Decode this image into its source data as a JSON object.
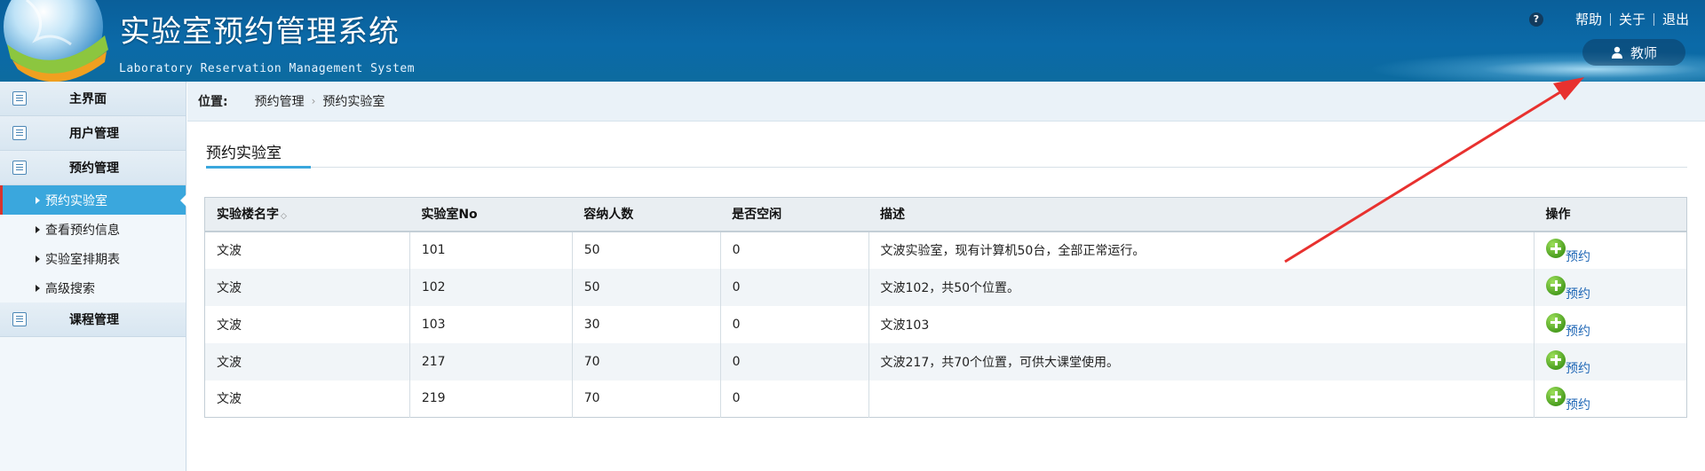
{
  "header": {
    "title": "实验室预约管理系统",
    "subtitle": "Laboratory Reservation Management System",
    "help_icon": "?",
    "links": [
      "帮助",
      "关于",
      "退出"
    ],
    "user_label": "教师",
    "user_icon": "user-icon"
  },
  "sidebar": {
    "sections": [
      {
        "label": "主界面",
        "icon": "list-icon"
      },
      {
        "label": "用户管理",
        "icon": "list-icon"
      },
      {
        "label": "预约管理",
        "icon": "list-icon"
      },
      {
        "label": "课程管理",
        "icon": "list-icon"
      }
    ],
    "items": [
      {
        "label": "预约实验室",
        "active": true
      },
      {
        "label": "查看预约信息",
        "active": false
      },
      {
        "label": "实验室排期表",
        "active": false
      },
      {
        "label": "高级搜索",
        "active": false
      }
    ]
  },
  "breadcrumb": {
    "label": "位置:",
    "path": [
      "预约管理",
      "预约实验室"
    ],
    "separator": "›"
  },
  "page": {
    "section_title": "预约实验室"
  },
  "table": {
    "columns": [
      "实验楼名字",
      "实验室No",
      "容纳人数",
      "是否空闲",
      "描述",
      "操作"
    ],
    "sort_icon": "◇",
    "action_label": "预约",
    "rows": [
      [
        "文波",
        "101",
        "50",
        "0",
        "文波实验室，现有计算机50台，全部正常运行。"
      ],
      [
        "文波",
        "102",
        "50",
        "0",
        "文波102，共50个位置。"
      ],
      [
        "文波",
        "103",
        "30",
        "0",
        "文波103"
      ],
      [
        "文波",
        "217",
        "70",
        "0",
        "文波217，共70个位置，可供大课堂使用。"
      ],
      [
        "文波",
        "219",
        "70",
        "0",
        ""
      ]
    ]
  },
  "colors": {
    "header_bg": "#0b6aa8",
    "sidebar_active": "#3aa7dd",
    "annotation_arrow": "#e8312f",
    "action_link": "#1e66b5"
  }
}
